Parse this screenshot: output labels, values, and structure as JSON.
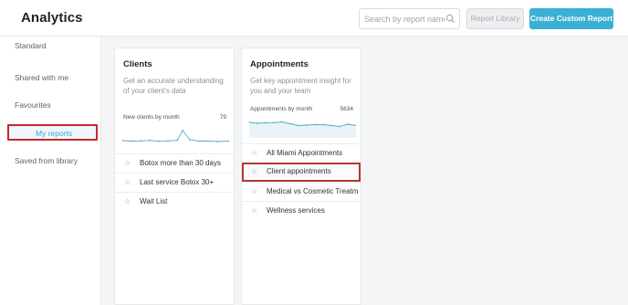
{
  "header": {
    "title": "Analytics",
    "search_placeholder": "Search by report name",
    "search_value": "",
    "report_library_label": "Report Library",
    "create_report_label": "Create Custom Report"
  },
  "sidebar": {
    "items": [
      {
        "label": "Standard"
      },
      {
        "label": "Shared with me"
      },
      {
        "label": "Favourites"
      },
      {
        "label": "My reports",
        "selected": true
      },
      {
        "label": "Saved from library"
      }
    ]
  },
  "cards": [
    {
      "title": "Clients",
      "description": "Get an accurate understanding of your client's data",
      "chart_label": "New clients by month",
      "chart_count": "79",
      "reports": [
        {
          "label": "Botox more than 30 days"
        },
        {
          "label": "Last service Botox 30+"
        },
        {
          "label": "Wait List"
        }
      ]
    },
    {
      "title": "Appointments",
      "description": "Get key appointment insight for you and your team",
      "chart_label": "Appointments by month",
      "chart_count": "5634",
      "reports": [
        {
          "label": "All Miami Appointments"
        },
        {
          "label": "Client appointments",
          "highlighted": true
        },
        {
          "label": "Medical vs Cosmetic Treatme"
        },
        {
          "label": "Wellness services"
        }
      ]
    }
  ],
  "colors": {
    "accent": "#3ab0d5",
    "highlight_border": "#c62828",
    "selected_bg": "#eef7fb"
  }
}
